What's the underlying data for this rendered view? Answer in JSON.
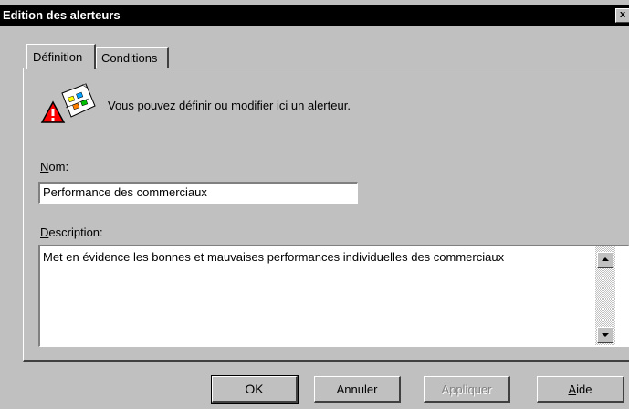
{
  "window": {
    "title": "Edition des alerteurs",
    "close_glyph": "x"
  },
  "tabs": [
    {
      "label": "Définition",
      "active": true
    },
    {
      "label": "Conditions",
      "active": false
    }
  ],
  "intro": {
    "icon": "alert-document-icon",
    "text": "Vous pouvez définir ou modifier ici un alerteur."
  },
  "nom": {
    "label_accel": "N",
    "label_rest": "om:",
    "value": "Performance des commerciaux"
  },
  "description": {
    "label_accel": "D",
    "label_rest": "escription:",
    "value": "Met en évidence les bonnes et mauvaises performances individuelles des commerciaux"
  },
  "buttons": {
    "ok": "OK",
    "cancel": "Annuler",
    "apply": "Appliquer",
    "help_accel": "A",
    "help_rest": "ide"
  },
  "colors": {
    "face": "#c0c0c0",
    "titlebar": "#000000",
    "disabled_text": "#808080"
  }
}
